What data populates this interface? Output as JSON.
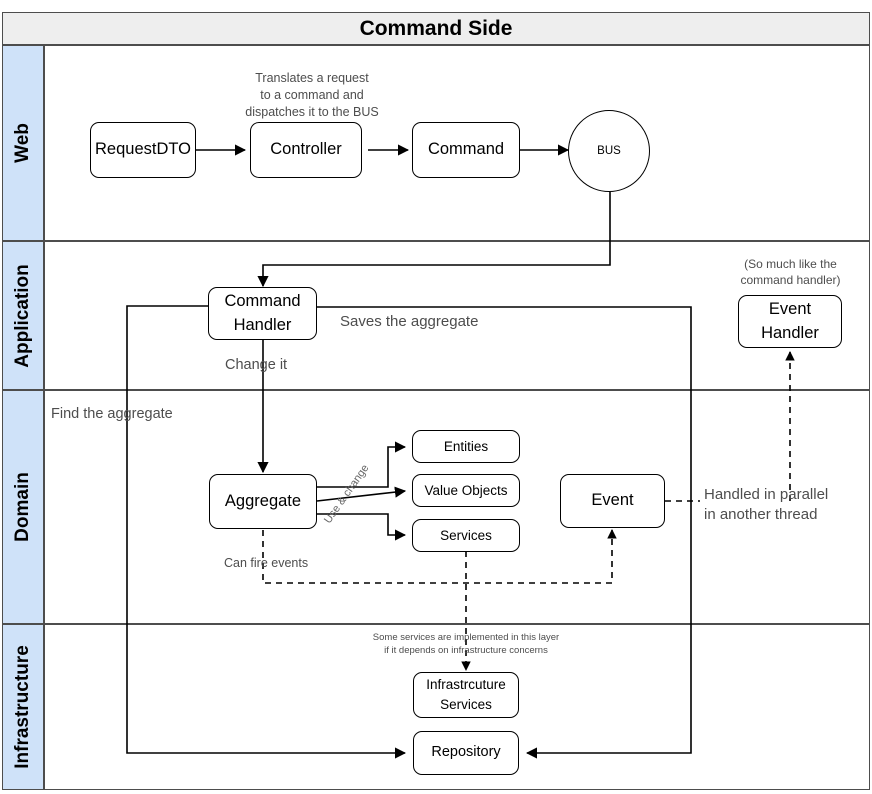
{
  "diagram": {
    "title": "Command Side",
    "type": "layered-architecture-swimlane",
    "lanes": [
      {
        "id": "web",
        "label": "Web"
      },
      {
        "id": "application",
        "label": "Application"
      },
      {
        "id": "domain",
        "label": "Domain"
      },
      {
        "id": "infrastructure",
        "label": "Infrastructure"
      }
    ]
  },
  "nodes": {
    "request_dto": "RequestDTO",
    "controller": "Controller",
    "command": "Command",
    "bus": "BUS",
    "command_handler": "Command\nHandler",
    "event_handler": "Event\nHandler",
    "aggregate": "Aggregate",
    "entities": "Entities",
    "value_objects": "Value Objects",
    "services": "Services",
    "event": "Event",
    "infrastructure_services": "Infrastrcuture\nServices",
    "repository": "Repository"
  },
  "annotations": {
    "translates": "Translates a request\nto a command and\ndispatches it to the BUS",
    "so_much_like": "(So much like the\ncommand handler)",
    "saves_aggregate": "Saves the aggregate",
    "change_it": "Change it",
    "find_aggregate": "Find the aggregate",
    "use_and_change": "Use & change",
    "can_fire_events": "Can fire events",
    "handled_parallel": "Handled in parallel\nin another thread",
    "some_services": "Some services are implemented in this layer\nif it depends on infrastructure concerns"
  },
  "colors": {
    "lane_label_fill": "#CFE2F9",
    "title_fill": "#EEEEEE",
    "lane_border": "#4d4d4d",
    "node_border": "#000000",
    "node_fill": "#ffffff",
    "annotation_text": "#4d4d4d",
    "edge_stroke": "#000000"
  }
}
